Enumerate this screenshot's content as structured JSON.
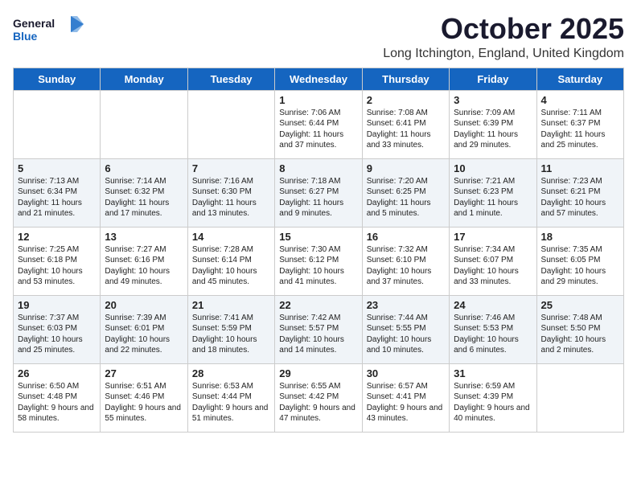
{
  "header": {
    "logo_general": "General",
    "logo_blue": "Blue",
    "month_title": "October 2025",
    "location": "Long Itchington, England, United Kingdom"
  },
  "weekdays": [
    "Sunday",
    "Monday",
    "Tuesday",
    "Wednesday",
    "Thursday",
    "Friday",
    "Saturday"
  ],
  "weeks": [
    [
      {
        "day": "",
        "sunrise": "",
        "sunset": "",
        "daylight": ""
      },
      {
        "day": "",
        "sunrise": "",
        "sunset": "",
        "daylight": ""
      },
      {
        "day": "",
        "sunrise": "",
        "sunset": "",
        "daylight": ""
      },
      {
        "day": "1",
        "sunrise": "Sunrise: 7:06 AM",
        "sunset": "Sunset: 6:44 PM",
        "daylight": "Daylight: 11 hours and 37 minutes."
      },
      {
        "day": "2",
        "sunrise": "Sunrise: 7:08 AM",
        "sunset": "Sunset: 6:41 PM",
        "daylight": "Daylight: 11 hours and 33 minutes."
      },
      {
        "day": "3",
        "sunrise": "Sunrise: 7:09 AM",
        "sunset": "Sunset: 6:39 PM",
        "daylight": "Daylight: 11 hours and 29 minutes."
      },
      {
        "day": "4",
        "sunrise": "Sunrise: 7:11 AM",
        "sunset": "Sunset: 6:37 PM",
        "daylight": "Daylight: 11 hours and 25 minutes."
      }
    ],
    [
      {
        "day": "5",
        "sunrise": "Sunrise: 7:13 AM",
        "sunset": "Sunset: 6:34 PM",
        "daylight": "Daylight: 11 hours and 21 minutes."
      },
      {
        "day": "6",
        "sunrise": "Sunrise: 7:14 AM",
        "sunset": "Sunset: 6:32 PM",
        "daylight": "Daylight: 11 hours and 17 minutes."
      },
      {
        "day": "7",
        "sunrise": "Sunrise: 7:16 AM",
        "sunset": "Sunset: 6:30 PM",
        "daylight": "Daylight: 11 hours and 13 minutes."
      },
      {
        "day": "8",
        "sunrise": "Sunrise: 7:18 AM",
        "sunset": "Sunset: 6:27 PM",
        "daylight": "Daylight: 11 hours and 9 minutes."
      },
      {
        "day": "9",
        "sunrise": "Sunrise: 7:20 AM",
        "sunset": "Sunset: 6:25 PM",
        "daylight": "Daylight: 11 hours and 5 minutes."
      },
      {
        "day": "10",
        "sunrise": "Sunrise: 7:21 AM",
        "sunset": "Sunset: 6:23 PM",
        "daylight": "Daylight: 11 hours and 1 minute."
      },
      {
        "day": "11",
        "sunrise": "Sunrise: 7:23 AM",
        "sunset": "Sunset: 6:21 PM",
        "daylight": "Daylight: 10 hours and 57 minutes."
      }
    ],
    [
      {
        "day": "12",
        "sunrise": "Sunrise: 7:25 AM",
        "sunset": "Sunset: 6:18 PM",
        "daylight": "Daylight: 10 hours and 53 minutes."
      },
      {
        "day": "13",
        "sunrise": "Sunrise: 7:27 AM",
        "sunset": "Sunset: 6:16 PM",
        "daylight": "Daylight: 10 hours and 49 minutes."
      },
      {
        "day": "14",
        "sunrise": "Sunrise: 7:28 AM",
        "sunset": "Sunset: 6:14 PM",
        "daylight": "Daylight: 10 hours and 45 minutes."
      },
      {
        "day": "15",
        "sunrise": "Sunrise: 7:30 AM",
        "sunset": "Sunset: 6:12 PM",
        "daylight": "Daylight: 10 hours and 41 minutes."
      },
      {
        "day": "16",
        "sunrise": "Sunrise: 7:32 AM",
        "sunset": "Sunset: 6:10 PM",
        "daylight": "Daylight: 10 hours and 37 minutes."
      },
      {
        "day": "17",
        "sunrise": "Sunrise: 7:34 AM",
        "sunset": "Sunset: 6:07 PM",
        "daylight": "Daylight: 10 hours and 33 minutes."
      },
      {
        "day": "18",
        "sunrise": "Sunrise: 7:35 AM",
        "sunset": "Sunset: 6:05 PM",
        "daylight": "Daylight: 10 hours and 29 minutes."
      }
    ],
    [
      {
        "day": "19",
        "sunrise": "Sunrise: 7:37 AM",
        "sunset": "Sunset: 6:03 PM",
        "daylight": "Daylight: 10 hours and 25 minutes."
      },
      {
        "day": "20",
        "sunrise": "Sunrise: 7:39 AM",
        "sunset": "Sunset: 6:01 PM",
        "daylight": "Daylight: 10 hours and 22 minutes."
      },
      {
        "day": "21",
        "sunrise": "Sunrise: 7:41 AM",
        "sunset": "Sunset: 5:59 PM",
        "daylight": "Daylight: 10 hours and 18 minutes."
      },
      {
        "day": "22",
        "sunrise": "Sunrise: 7:42 AM",
        "sunset": "Sunset: 5:57 PM",
        "daylight": "Daylight: 10 hours and 14 minutes."
      },
      {
        "day": "23",
        "sunrise": "Sunrise: 7:44 AM",
        "sunset": "Sunset: 5:55 PM",
        "daylight": "Daylight: 10 hours and 10 minutes."
      },
      {
        "day": "24",
        "sunrise": "Sunrise: 7:46 AM",
        "sunset": "Sunset: 5:53 PM",
        "daylight": "Daylight: 10 hours and 6 minutes."
      },
      {
        "day": "25",
        "sunrise": "Sunrise: 7:48 AM",
        "sunset": "Sunset: 5:50 PM",
        "daylight": "Daylight: 10 hours and 2 minutes."
      }
    ],
    [
      {
        "day": "26",
        "sunrise": "Sunrise: 6:50 AM",
        "sunset": "Sunset: 4:48 PM",
        "daylight": "Daylight: 9 hours and 58 minutes."
      },
      {
        "day": "27",
        "sunrise": "Sunrise: 6:51 AM",
        "sunset": "Sunset: 4:46 PM",
        "daylight": "Daylight: 9 hours and 55 minutes."
      },
      {
        "day": "28",
        "sunrise": "Sunrise: 6:53 AM",
        "sunset": "Sunset: 4:44 PM",
        "daylight": "Daylight: 9 hours and 51 minutes."
      },
      {
        "day": "29",
        "sunrise": "Sunrise: 6:55 AM",
        "sunset": "Sunset: 4:42 PM",
        "daylight": "Daylight: 9 hours and 47 minutes."
      },
      {
        "day": "30",
        "sunrise": "Sunrise: 6:57 AM",
        "sunset": "Sunset: 4:41 PM",
        "daylight": "Daylight: 9 hours and 43 minutes."
      },
      {
        "day": "31",
        "sunrise": "Sunrise: 6:59 AM",
        "sunset": "Sunset: 4:39 PM",
        "daylight": "Daylight: 9 hours and 40 minutes."
      },
      {
        "day": "",
        "sunrise": "",
        "sunset": "",
        "daylight": ""
      }
    ]
  ]
}
